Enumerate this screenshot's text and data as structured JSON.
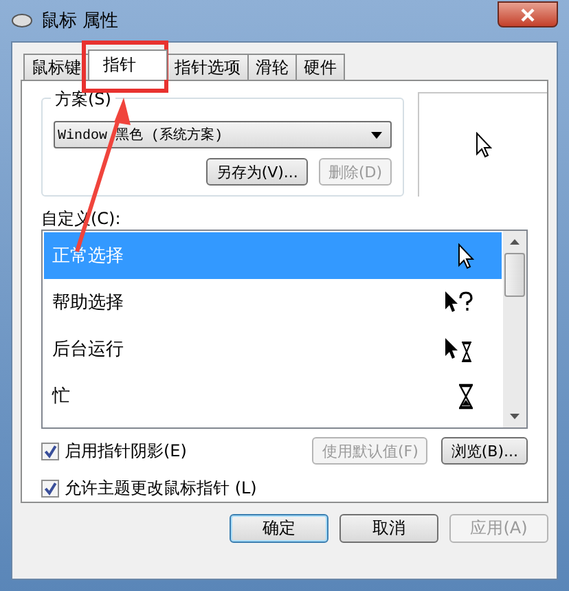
{
  "window": {
    "title": "鼠标 属性"
  },
  "tabs": [
    {
      "label": "鼠标键",
      "selected": false
    },
    {
      "label": "指针",
      "selected": true
    },
    {
      "label": "指针选项",
      "selected": false
    },
    {
      "label": "滑轮",
      "selected": false
    },
    {
      "label": "硬件",
      "selected": false
    }
  ],
  "scheme": {
    "label": "方案(S)",
    "value": "Window 黑色 (系统方案)",
    "buttons": [
      {
        "label": "另存为(V)...",
        "disabled": false
      },
      {
        "label": "删除(D)",
        "disabled": true
      }
    ]
  },
  "customize": {
    "label": "自定义(C):",
    "cursors": [
      {
        "name": "正常选择",
        "kind": "normal",
        "selected": true
      },
      {
        "name": "帮助选择",
        "kind": "help",
        "selected": false
      },
      {
        "name": "后台运行",
        "kind": "working",
        "selected": false
      },
      {
        "name": "忙",
        "kind": "busy",
        "selected": false
      }
    ]
  },
  "options": [
    {
      "label": "启用指针阴影(E)",
      "checked": true
    },
    {
      "label": "允许主题更改鼠标指针 (L)",
      "checked": true
    }
  ],
  "list_buttons": [
    {
      "label": "使用默认值(F)",
      "disabled": true
    },
    {
      "label": "浏览(B)...",
      "disabled": false
    }
  ],
  "dialog_buttons": [
    {
      "label": "确定",
      "disabled": false,
      "default": true
    },
    {
      "label": "取消",
      "disabled": false,
      "default": false
    },
    {
      "label": "应用(A)",
      "disabled": true,
      "default": false
    }
  ]
}
